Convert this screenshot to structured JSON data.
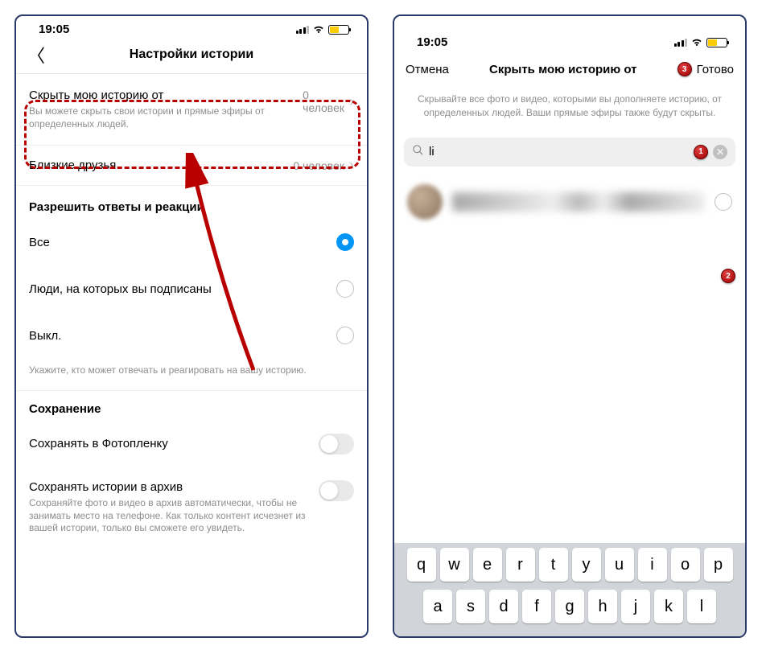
{
  "status_bar": {
    "time": "19:05"
  },
  "left": {
    "title": "Настройки истории",
    "hide_story": {
      "label": "Скрыть мою историю от",
      "value": "0 человек",
      "sub": "Вы можете скрыть свои истории и прямые эфиры от определенных людей."
    },
    "close_friends": {
      "label": "Близкие друзья",
      "value": "0 человек"
    },
    "replies": {
      "section": "Разрешить ответы и реакции",
      "opt_all": "Все",
      "opt_following": "Люди, на которых вы подписаны",
      "opt_off": "Выкл.",
      "footnote": "Укажите, кто может отвечать и реагировать на вашу историю."
    },
    "saving": {
      "section": "Сохранение",
      "save_camera": "Сохранять в Фотопленку",
      "save_archive": "Сохранять истории в архив",
      "archive_sub": "Сохраняйте фото и видео в архив автоматически, чтобы не занимать место на телефоне. Как только контент исчезнет из вашей истории, только вы сможете его увидеть."
    }
  },
  "right": {
    "cancel": "Отмена",
    "title": "Скрыть мою историю от",
    "done": "Готово",
    "desc": "Скрывайте все фото и видео, которыми вы дополняете историю, от определенных людей. Ваши прямые эфиры также будут скрыты.",
    "search_value": "li",
    "badges": {
      "b1": "1",
      "b2": "2",
      "b3": "3"
    },
    "keyboard": {
      "row1": [
        "q",
        "w",
        "e",
        "r",
        "t",
        "y",
        "u",
        "i",
        "o",
        "p"
      ],
      "row2": [
        "a",
        "s",
        "d",
        "f",
        "g",
        "h",
        "j",
        "k",
        "l"
      ]
    }
  }
}
